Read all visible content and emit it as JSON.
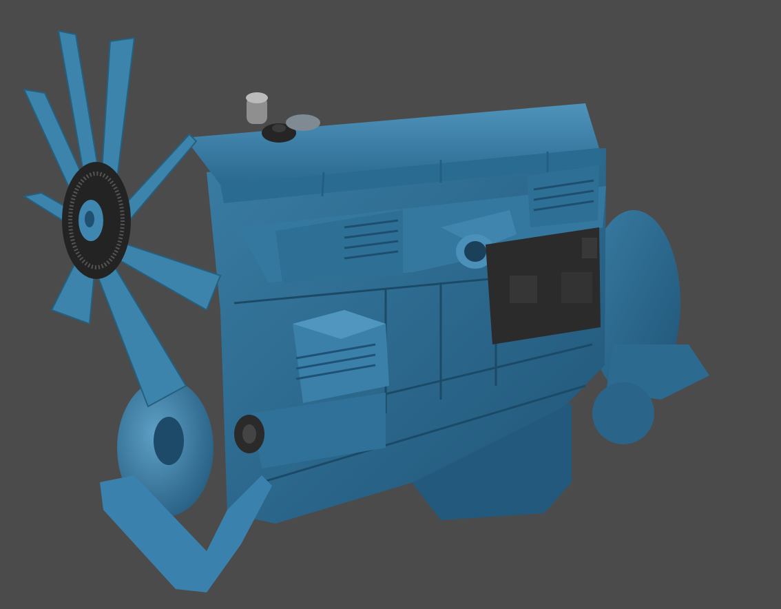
{
  "scene": {
    "subject": "engine-3d-render",
    "colors": {
      "background": "#4b4b4b",
      "engine_body": "#2e6d93",
      "engine_light": "#4a8db5",
      "engine_dark": "#1c4662",
      "ecu_black": "#2b2b2b",
      "metal": "#9a9a9a"
    }
  }
}
